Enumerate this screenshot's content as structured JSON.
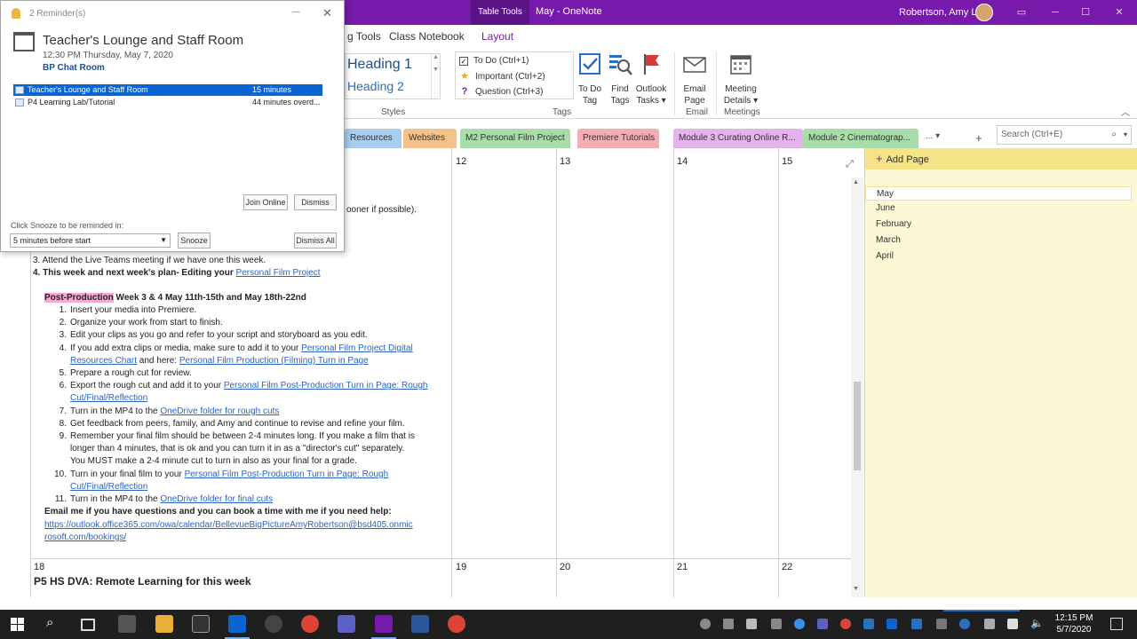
{
  "titlebar": {
    "context_tab": "Table Tools",
    "document": "May  -  OneNote",
    "user": "Robertson, Amy L"
  },
  "ribbon_tabs": [
    "g Tools",
    "Class Notebook",
    "Layout"
  ],
  "ribbon": {
    "styles": {
      "heading1": "Heading 1",
      "heading2": "Heading 2",
      "group": "Styles"
    },
    "tags": {
      "items": [
        "To Do (Ctrl+1)",
        "Important (Ctrl+2)",
        "Question (Ctrl+3)"
      ],
      "group": "Tags"
    },
    "todo_tag": [
      "To Do",
      "Tag"
    ],
    "find_tags": [
      "Find",
      "Tags"
    ],
    "outlook_tasks": [
      "Outlook",
      "Tasks ▾"
    ],
    "email_page": [
      "Email",
      "Page"
    ],
    "email_group": "Email",
    "meeting_details": [
      "Meeting",
      "Details ▾"
    ],
    "meetings_group": "Meetings"
  },
  "sections": [
    {
      "label": "Resources",
      "color": "#a9cdee"
    },
    {
      "label": "Websites",
      "color": "#f6c28a"
    },
    {
      "label": "M2 Personal Film Project",
      "color": "#a8dca8"
    },
    {
      "label": "Premiere Tutorials",
      "color": "#f4aeb3"
    },
    {
      "label": "Module 3 Curating Online R...",
      "color": "#e4b3ec"
    },
    {
      "label": "Module 2 Cinematograp...",
      "color": "#a8dca8"
    }
  ],
  "sections_more": "...",
  "add_section": "+",
  "search_placeholder": "Search (Ctrl+E)",
  "calendar": {
    "top_days": [
      "12",
      "13",
      "14",
      "15"
    ],
    "bottom_first_day": "18",
    "bottom_days": [
      "19",
      "20",
      "21",
      "22"
    ],
    "bottom_title": "P5 HS DVA: Remote Learning for this week",
    "partial_line": "ooner if possible).",
    "step3": "3.  Attend the Live Teams meeting if we have one this week.",
    "step4_prefix": "4.  This week and next week's plan- Editing your ",
    "step4_link": "Personal Film Project",
    "post_label": "Post-Production",
    "post_rest": " Week 3 & 4 May 11th-15th and May 18th-22nd",
    "steps": [
      {
        "num": "1.",
        "lines": [
          [
            {
              "t": "Insert your media into Premiere."
            }
          ]
        ]
      },
      {
        "num": "2.",
        "lines": [
          [
            {
              "t": "Organize your work from start to finish."
            }
          ]
        ]
      },
      {
        "num": "3.",
        "lines": [
          [
            {
              "t": "Edit your clips as you go and refer to your script and storyboard as you edit."
            }
          ]
        ]
      },
      {
        "num": "4.",
        "lines": [
          [
            {
              "t": "If you add extra clips or media, make sure to add it to your "
            },
            {
              "t": "Personal Film Project Digital",
              "l": 1
            }
          ],
          [
            {
              "t": "Resources Chart",
              "l": 1
            },
            {
              "t": " and here: "
            },
            {
              "t": "Personal Film Production (Filming) Turn in Page",
              "l": 1
            }
          ]
        ]
      },
      {
        "num": "5.",
        "lines": [
          [
            {
              "t": "Prepare a rough cut for review."
            }
          ]
        ]
      },
      {
        "num": "6.",
        "lines": [
          [
            {
              "t": "Export the rough cut and add it to your "
            },
            {
              "t": "Personal Film Post-Production Turn in Page: Rough",
              "l": 1
            }
          ],
          [
            {
              "t": "Cut/Final/Reflection",
              "l": 1
            }
          ]
        ]
      },
      {
        "num": "7.",
        "lines": [
          [
            {
              "t": "Turn in the MP4 to the "
            },
            {
              "t": "OneDrive folder for rough cuts",
              "l": 1
            }
          ]
        ]
      },
      {
        "num": "8.",
        "lines": [
          [
            {
              "t": "Get feedback from peers, family, and Amy and continue to revise and refine your film."
            }
          ]
        ]
      },
      {
        "num": "9.",
        "lines": [
          [
            {
              "t": "Remember your final film should be between 2-4 minutes long.  If you make a film that is"
            }
          ],
          [
            {
              "t": "longer than 4 minutes, that is ok and you can turn it in as a \"director's cut\" separately."
            }
          ],
          [
            {
              "t": "You MUST make a 2-4 minute cut to turn in also as your final for a grade."
            }
          ]
        ]
      },
      {
        "num": "10.",
        "lines": [
          [
            {
              "t": "Turn in your final film to your "
            },
            {
              "t": "Personal Film Post-Production Turn in Page: Rough",
              "l": 1
            }
          ],
          [
            {
              "t": "Cut/Final/Reflection",
              "l": 1
            }
          ]
        ]
      },
      {
        "num": "11.",
        "lines": [
          [
            {
              "t": "Turn in the MP4 to the "
            },
            {
              "t": "OneDrive folder for final cuts",
              "l": 1
            }
          ]
        ]
      }
    ],
    "email_line": "Email me if you have questions and you can book a time with me if you need help:",
    "booking_link_1": "https://outlook.office365.com/owa/calendar/BellevueBigPictureAmyRobertson@bsd405.onmic",
    "booking_link_2": "rosoft.com/bookings/"
  },
  "pages": {
    "add_page": "Add Page",
    "items": [
      "May",
      "June",
      "February",
      "March",
      "April"
    ]
  },
  "reminder": {
    "title": "2 Reminder(s)",
    "subject": "Teacher's Lounge and Staff Room",
    "when": "12:30 PM Thursday, May 7, 2020",
    "where": "BP Chat Room",
    "items": [
      {
        "name": "Teacher's Lounge and Staff Room",
        "due": "15 minutes"
      },
      {
        "name": "P4 Learning Lab/Tutorial",
        "due": "44 minutes overd..."
      }
    ],
    "join_online": "Join Online",
    "dismiss": "Dismiss",
    "snooze_label": "Click Snooze to be reminded in:",
    "snooze_value": "5 minutes before start",
    "snooze": "Snooze",
    "dismiss_all": "Dismiss All"
  },
  "taskbar": {
    "time": "12:15 PM",
    "date": "5/7/2020"
  }
}
